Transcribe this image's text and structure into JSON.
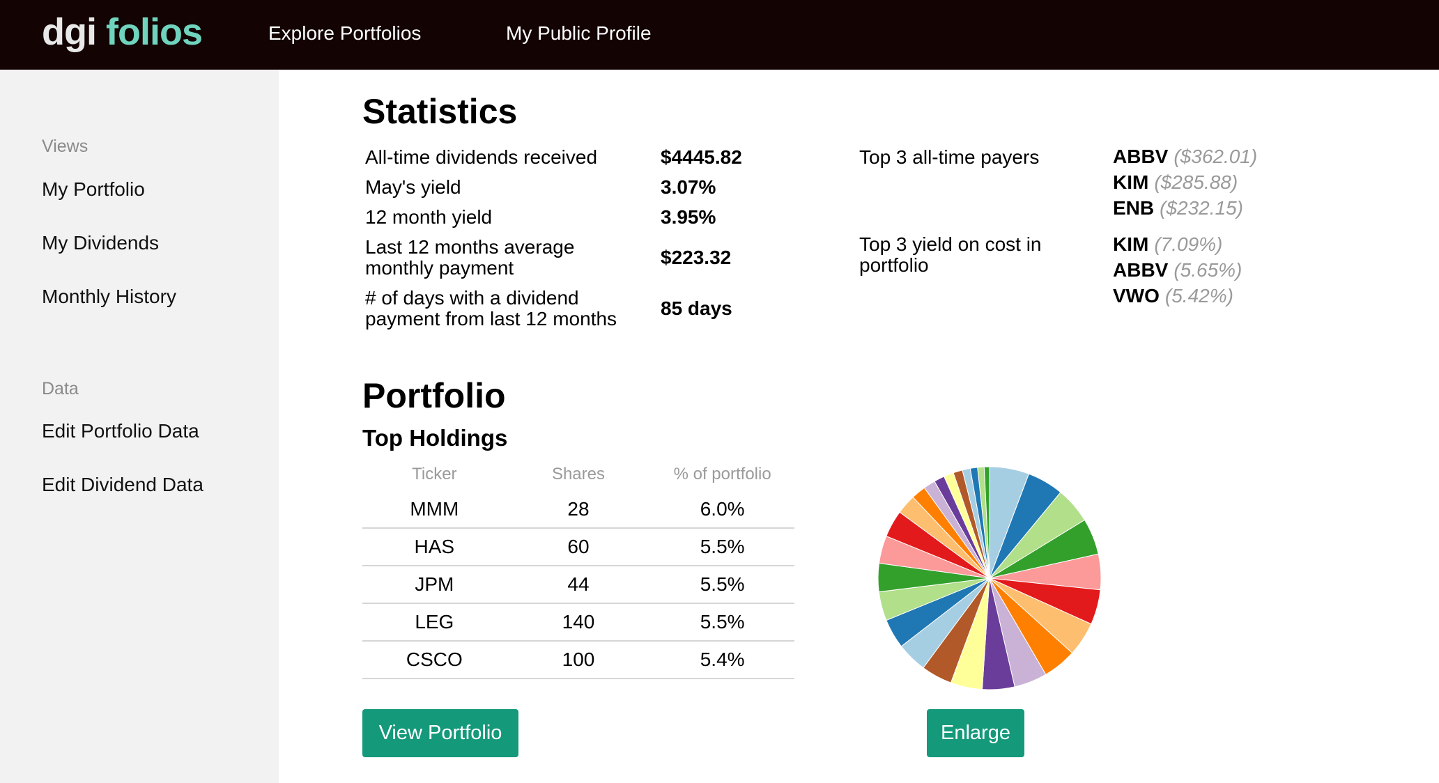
{
  "header": {
    "logo_part1": "dgi",
    "logo_part2": "folios",
    "nav": [
      "Explore Portfolios",
      "My Public Profile"
    ]
  },
  "sidebar": {
    "views_label": "Views",
    "views_items": [
      "My Portfolio",
      "My Dividends",
      "Monthly History"
    ],
    "data_label": "Data",
    "data_items": [
      "Edit Portfolio Data",
      "Edit Dividend Data"
    ]
  },
  "statistics": {
    "title": "Statistics",
    "rows": [
      {
        "label": "All-time dividends received",
        "value": "$4445.82"
      },
      {
        "label": "May's yield",
        "value": "3.07%"
      },
      {
        "label": "12 month yield",
        "value": "3.95%"
      },
      {
        "label": "Last 12 months average monthly payment",
        "value": "$223.32"
      },
      {
        "label": "# of days with a dividend payment from last 12 months",
        "value": "85 days"
      }
    ],
    "top_payers_label": "Top 3 all-time payers",
    "top_payers": [
      {
        "ticker": "ABBV",
        "amount": "($362.01)"
      },
      {
        "ticker": "KIM",
        "amount": "($285.88)"
      },
      {
        "ticker": "ENB",
        "amount": "($232.15)"
      }
    ],
    "top_yield_label": "Top 3 yield on cost in portfolio",
    "top_yield": [
      {
        "ticker": "KIM",
        "amount": "(7.09%)"
      },
      {
        "ticker": "ABBV",
        "amount": "(5.65%)"
      },
      {
        "ticker": "VWO",
        "amount": "(5.42%)"
      }
    ]
  },
  "portfolio": {
    "title": "Portfolio",
    "holdings_title": "Top Holdings",
    "columns": [
      "Ticker",
      "Shares",
      "% of portfolio"
    ],
    "rows": [
      [
        "MMM",
        "28",
        "6.0%"
      ],
      [
        "HAS",
        "60",
        "5.5%"
      ],
      [
        "JPM",
        "44",
        "5.5%"
      ],
      [
        "LEG",
        "140",
        "5.5%"
      ],
      [
        "CSCO",
        "100",
        "5.4%"
      ]
    ],
    "view_button": "View Portfolio",
    "enlarge_button": "Enlarge"
  },
  "chart_data": {
    "type": "pie",
    "values": [
      6.0,
      5.5,
      5.5,
      5.5,
      5.4,
      5.3,
      5.2,
      5.1,
      5.0,
      4.9,
      4.8,
      4.7,
      4.6,
      4.5,
      4.4,
      4.3,
      4.2,
      4.1,
      3.0,
      2.2,
      1.8,
      1.6,
      1.5,
      1.4,
      1.2,
      1.1,
      1.0,
      0.8
    ],
    "colors": [
      "#a6cee3",
      "#1f78b4",
      "#b2df8a",
      "#33a02c",
      "#fb9a99",
      "#e31a1c",
      "#fdbf6f",
      "#ff7f00",
      "#cab2d6",
      "#6a3d9a",
      "#ffff99",
      "#b15928",
      "#a6cee3",
      "#1f78b4",
      "#b2df8a",
      "#33a02c",
      "#fb9a99",
      "#e31a1c",
      "#fdbf6f",
      "#ff7f00",
      "#cab2d6",
      "#6a3d9a",
      "#ffff99",
      "#b15928",
      "#a6cee3",
      "#1f78b4",
      "#b2df8a",
      "#33a02c"
    ]
  }
}
